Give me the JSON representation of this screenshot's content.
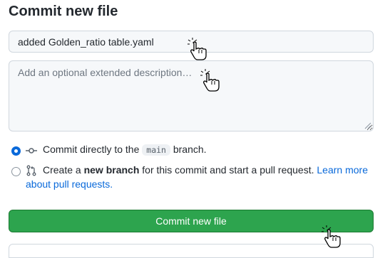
{
  "form": {
    "title": "Commit new file",
    "summary_value": "added Golden_ratio table.yaml",
    "description_placeholder": "Add an optional extended description…"
  },
  "options": {
    "direct": {
      "text_before": "Commit directly to the",
      "branch": "main",
      "text_after": "branch."
    },
    "new_branch": {
      "text_before": "Create a",
      "bold": "new branch",
      "text_after": "for this commit and start a pull request.",
      "link_line1": "Learn more",
      "link_line2": "about pull requests."
    }
  },
  "button": {
    "label": "Commit new file"
  },
  "colors": {
    "accent": "#0969da",
    "primary_button": "#2da44e",
    "border": "#d0d7de"
  },
  "icons": {
    "commit": "git-commit-icon",
    "pull_request": "git-pull-request-icon",
    "cursor": "hand-pointer-cursor-icon"
  }
}
